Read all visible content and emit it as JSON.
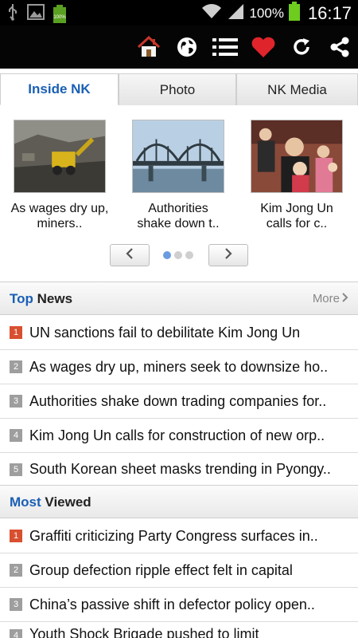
{
  "statusbar": {
    "battery_text": "100%",
    "time": "16:17",
    "small_battery": "100%"
  },
  "tabs": [
    "Inside NK",
    "Photo",
    "NK Media"
  ],
  "carousel": {
    "cards": [
      {
        "caption_l1": "As wages dry up,",
        "caption_l2": "miners.."
      },
      {
        "caption_l1": "Authorities",
        "caption_l2": "shake down t.."
      },
      {
        "caption_l1": "Kim Jong Un",
        "caption_l2": "calls for c.."
      }
    ]
  },
  "top_news": {
    "accent": "Top",
    "title": "News",
    "more": "More",
    "items": [
      {
        "num": "1",
        "text": "UN sanctions fail to debilitate Kim Jong Un"
      },
      {
        "num": "2",
        "text": "As wages dry up, miners seek to downsize ho.."
      },
      {
        "num": "3",
        "text": "Authorities shake down trading companies for.."
      },
      {
        "num": "4",
        "text": "Kim Jong Un calls for construction of new orp.."
      },
      {
        "num": "5",
        "text": "South Korean sheet masks trending in Pyongy.."
      }
    ]
  },
  "most_viewed": {
    "accent": "Most",
    "title": "Viewed",
    "items": [
      {
        "num": "1",
        "text": "Graffiti criticizing Party Congress surfaces in.."
      },
      {
        "num": "2",
        "text": "Group defection ripple effect felt in capital"
      },
      {
        "num": "3",
        "text": "China’s passive shift in defector policy open.."
      },
      {
        "num": "4",
        "text": "Youth Shock Brigade pushed to limit"
      }
    ]
  },
  "colors": {
    "accent_blue": "#1a5fb4",
    "first_badge": "#d8502f",
    "heart": "#e0242b"
  }
}
